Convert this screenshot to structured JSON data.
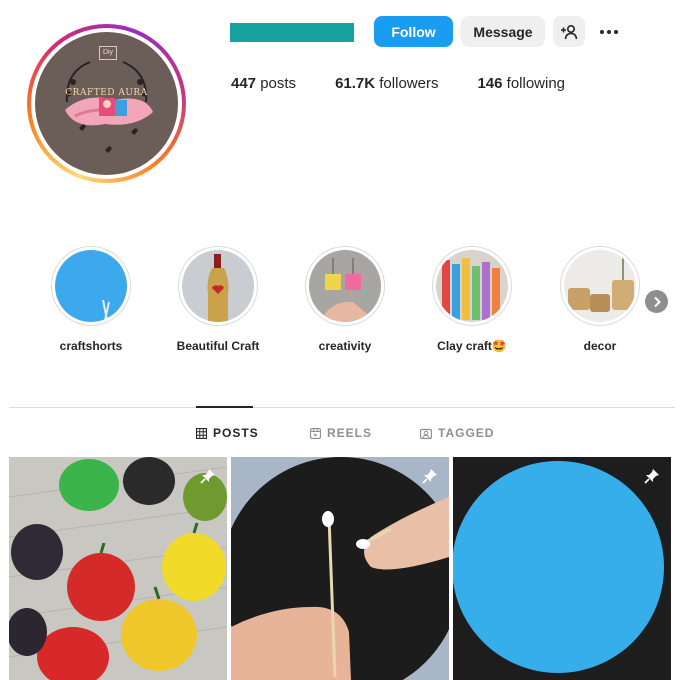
{
  "profile": {
    "avatar_logo_text": "CRAFTED AURA",
    "avatar_badge": "Diy",
    "follow_label": "Follow",
    "message_label": "Message",
    "add_user_icon": "person-plus-icon",
    "more_icon": "more-horizontal-icon",
    "stats": {
      "posts_count": "447",
      "posts_label": "posts",
      "followers_count": "61.7K",
      "followers_label": "followers",
      "following_count": "146",
      "following_label": "following"
    }
  },
  "highlights": [
    {
      "label": "craftshorts"
    },
    {
      "label": "Beautiful Craft"
    },
    {
      "label": "creativity"
    },
    {
      "label": "Clay craft🤩"
    },
    {
      "label": "decor"
    }
  ],
  "tabs": [
    {
      "label": "POSTS",
      "icon": "grid-icon",
      "active": true
    },
    {
      "label": "REELS",
      "icon": "reels-icon",
      "active": false
    },
    {
      "label": "TAGGED",
      "icon": "tagged-icon",
      "active": false
    }
  ],
  "posts": [
    {
      "subject": "clay bell peppers",
      "pinned": true
    },
    {
      "subject": "hand holding cotton swab",
      "pinned": true
    },
    {
      "subject": "blue paper circle",
      "pinned": true
    }
  ],
  "colors": {
    "follow_button": "#1a9cf0",
    "username_redaction": "#16a3a0",
    "avatar_background": "#6b5d58"
  }
}
